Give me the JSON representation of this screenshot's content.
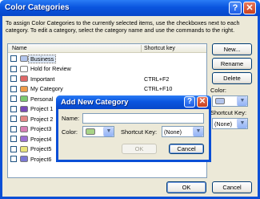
{
  "window": {
    "title": "Color Categories",
    "description": "To assign Color Categories to the currently selected items, use the checkboxes next to each category.  To edit a category, select the category name and use the commands to the right."
  },
  "list": {
    "columns": {
      "name": "Name",
      "shortcut": "Shortcut key"
    },
    "rows": [
      {
        "name": "Business",
        "color": "#b3c5ec",
        "shortcut": "",
        "selected": true
      },
      {
        "name": "Hold for Review",
        "color": "#ffffff",
        "shortcut": ""
      },
      {
        "name": "Important",
        "color": "#e06868",
        "shortcut": "CTRL+F2"
      },
      {
        "name": "My Category",
        "color": "#ef9c4a",
        "shortcut": "CTRL+F10"
      },
      {
        "name": "Personal",
        "color": "#7bc96f",
        "shortcut": ""
      },
      {
        "name": "Project 1",
        "color": "#7a4ab8",
        "shortcut": ""
      },
      {
        "name": "Project 2",
        "color": "#e38686",
        "shortcut": ""
      },
      {
        "name": "Project3",
        "color": "#d77fb4",
        "shortcut": ""
      },
      {
        "name": "Project4",
        "color": "#9b6fd2",
        "shortcut": ""
      },
      {
        "name": "Project5",
        "color": "#e8e37a",
        "shortcut": ""
      },
      {
        "name": "Project6",
        "color": "#7b78d4",
        "shortcut": ""
      }
    ]
  },
  "side": {
    "new_label": "New...",
    "rename_label": "Rename",
    "delete_label": "Delete",
    "color_label": "Color:",
    "color_value": "#b3c5ec",
    "shortcut_label": "Shortcut Key:",
    "shortcut_value": "(None)"
  },
  "footer": {
    "ok_label": "OK",
    "cancel_label": "Cancel"
  },
  "dialog": {
    "title": "Add New Category",
    "name_label": "Name:",
    "name_value": "",
    "color_label": "Color:",
    "color_value": "#a8d488",
    "shortcut_label": "Shortcut Key:",
    "shortcut_value": "(None)",
    "ok_label": "OK",
    "cancel_label": "Cancel"
  },
  "icons": {
    "help": "?",
    "close": "✕",
    "dropdown": "▼"
  }
}
